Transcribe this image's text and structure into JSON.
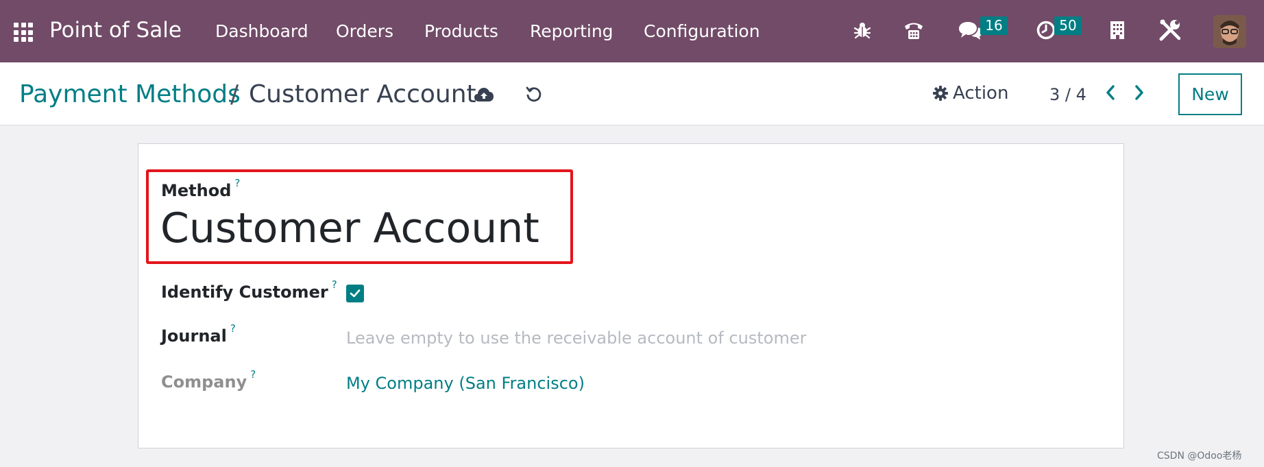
{
  "navbar": {
    "app_name": "Point of Sale",
    "menu": [
      "Dashboard",
      "Orders",
      "Products",
      "Reporting",
      "Configuration"
    ],
    "icons": [
      "apps-grid-icon",
      "bug-icon",
      "phone-icon",
      "chat-icon",
      "clock-icon",
      "building-icon",
      "tools-icon"
    ],
    "messages_badge": "16",
    "activities_badge": "50",
    "brand_color": "#714b67"
  },
  "control_panel": {
    "breadcrumb_parent": "Payment Methods",
    "breadcrumb_separator": "/",
    "breadcrumb_current": "Customer Account",
    "action_label": "Action",
    "pager": "3 / 4",
    "new_label": "New",
    "accent_color": "#017e84"
  },
  "form": {
    "method_label": "Method",
    "help_mark": "?",
    "method_value": "Customer Account",
    "identify_customer_label": "Identify Customer",
    "identify_customer_checked": true,
    "journal_label": "Journal",
    "journal_placeholder": "Leave empty to use the receivable account of customer",
    "company_label": "Company",
    "company_value": "My Company (San Francisco)",
    "highlight_color": "#e3151c"
  },
  "watermark": "CSDN @Odoo老杨"
}
